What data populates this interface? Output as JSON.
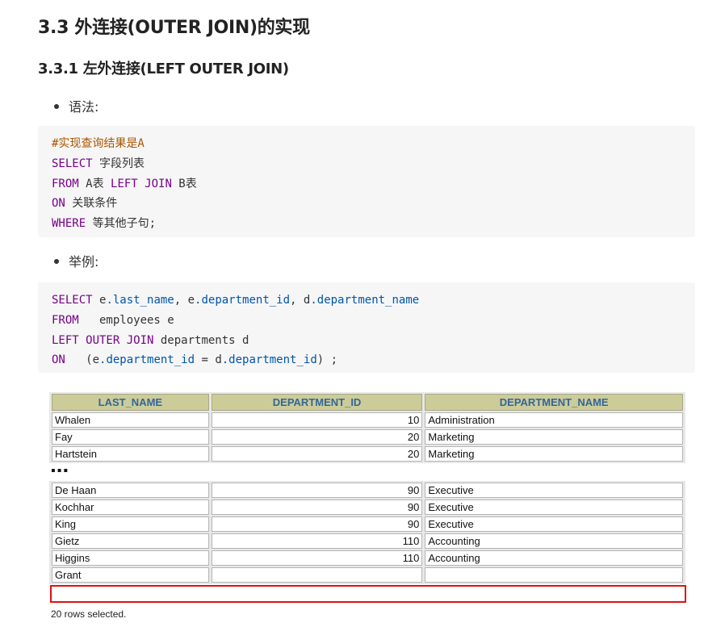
{
  "headings": {
    "h3": "3.3 外连接(OUTER JOIN)的实现",
    "h4": "3.3.1 左外连接(LEFT OUTER JOIN)"
  },
  "bullets": {
    "syntax": "语法:",
    "example": "举例:"
  },
  "syntax_code": {
    "comment": "#实现查询结果是A",
    "l1_kw": "SELECT",
    "l1_rest": " 字段列表",
    "l2_kw1": "FROM",
    "l2_mid": " A表 ",
    "l2_kw2": "LEFT JOIN",
    "l2_rest": " B表",
    "l3_kw": "ON",
    "l3_rest": " 关联条件",
    "l4_kw": "WHERE",
    "l4_rest": " 等其他子句;"
  },
  "example_code": {
    "l1_kw": "SELECT",
    "l1_a": " e",
    "l1_b": ".last_name",
    "l1_c": ", e",
    "l1_d": ".department_id",
    "l1_e": ", d",
    "l1_f": ".department_name",
    "l2_kw": "FROM",
    "l2_rest": "   employees e",
    "l3_kw": "LEFT OUTER JOIN",
    "l3_rest": " departments d",
    "l4_kw": "ON",
    "l4_a": "   (e",
    "l4_b": ".department_id",
    "l4_c": " = d",
    "l4_d": ".department_id",
    "l4_e": ") ;"
  },
  "result": {
    "headers": [
      "LAST_NAME",
      "DEPARTMENT_ID",
      "DEPARTMENT_NAME"
    ],
    "rows_top": [
      [
        "Whalen",
        "10",
        "Administration"
      ],
      [
        "Fay",
        "20",
        "Marketing"
      ],
      [
        "Hartstein",
        "20",
        "Marketing"
      ]
    ],
    "ellipsis": "▪▪▪",
    "rows_bottom": [
      [
        "De Haan",
        "90",
        "Executive"
      ],
      [
        "Kochhar",
        "90",
        "Executive"
      ],
      [
        "King",
        "90",
        "Executive"
      ],
      [
        "Gietz",
        "110",
        "Accounting"
      ],
      [
        "Higgins",
        "110",
        "Accounting"
      ],
      [
        "Grant",
        "",
        ""
      ]
    ],
    "footer": "20 rows selected.",
    "highlight_color": "#e01010",
    "header_bg": "#cccc99",
    "header_fg": "#336699"
  }
}
